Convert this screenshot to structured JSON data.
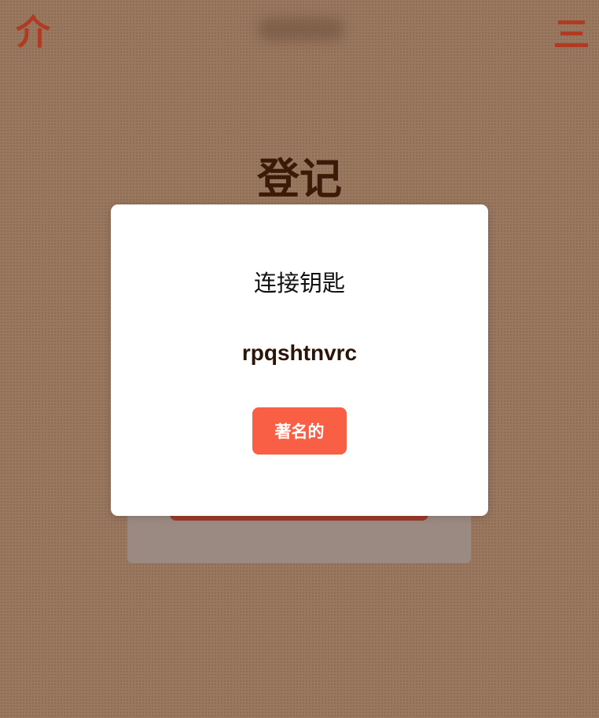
{
  "header": {
    "logo_glyph": "介",
    "menu_icon": "hamburger-menu-icon"
  },
  "page": {
    "title": "登记"
  },
  "modal": {
    "title": "连接钥匙",
    "key_value": "rpqshtnvrc",
    "button_label": "著名的"
  },
  "colors": {
    "accent": "#b03a22",
    "button": "#f95f45",
    "background": "#9a775f",
    "title_text": "#3b1a08"
  }
}
